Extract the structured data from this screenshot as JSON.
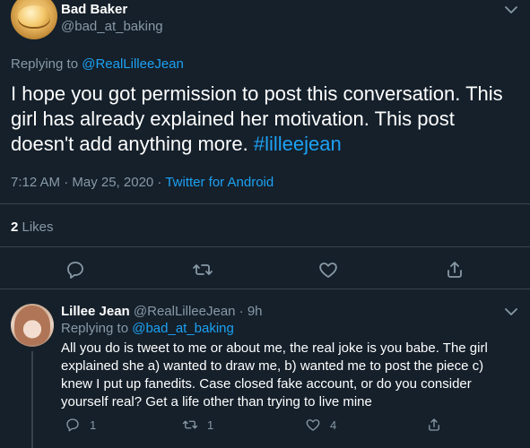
{
  "main_tweet": {
    "display_name": "Bad Baker",
    "handle": "@bad_at_baking",
    "replying_prefix": "Replying to ",
    "replying_to": "@RealLilleeJean",
    "text": "I hope you got permission to post this conversation. This girl has already explained her motivation. This post doesn't add anything more. ",
    "hashtag": "#lilleejean",
    "timestamp": "7:12 AM · May 25, 2020 · ",
    "source": "Twitter for Android",
    "likes_count": "2",
    "likes_label": " Likes"
  },
  "reply_tweet": {
    "display_name": "Lillee Jean",
    "handle_time": " @RealLilleeJean · 9h",
    "replying_prefix": "Replying to ",
    "replying_to": "@bad_at_baking",
    "text": "All you do is tweet to me or about me, the real joke is you babe. The girl explained she a) wanted to draw me, b) wanted me to post the piece c) knew I put up fanedits. Case closed fake account, or do you consider yourself real? Get a life other than trying to live mine",
    "reply_count": "1",
    "retweet_count": "1",
    "like_count": "4"
  },
  "icons": {
    "reply": "reply-icon",
    "retweet": "retweet-icon",
    "like": "heart-icon",
    "share": "share-icon",
    "more": "chevron-down-icon"
  },
  "colors": {
    "background": "#15202b",
    "text": "#ffffff",
    "secondary": "#8899a6",
    "link": "#1da1f2",
    "divider": "#38444d"
  }
}
